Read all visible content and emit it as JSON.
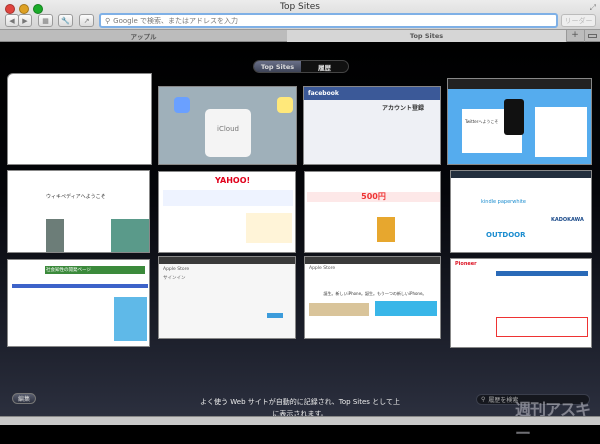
{
  "window": {
    "title": "Top Sites"
  },
  "toolbar": {
    "back": "◀",
    "forward": "▶",
    "address_placeholder": "Google で検索、またはアドレスを入力",
    "reader_label": "リーダー"
  },
  "tabs": [
    {
      "label": "アップル",
      "active": false
    },
    {
      "label": "Top Sites",
      "active": true
    }
  ],
  "tab_actions": {
    "new_tab": "+"
  },
  "segmented": {
    "top_sites": "Top Sites",
    "history": "履歴"
  },
  "thumbnails": [
    {
      "name": "blank",
      "label": ""
    },
    {
      "name": "icloud",
      "label": "iCloud"
    },
    {
      "name": "facebook",
      "label": "facebook",
      "sub": "アカウント登録"
    },
    {
      "name": "twitter",
      "label": "Twitterへようこそ"
    },
    {
      "name": "wikipedia",
      "label": "ウィキペディアへようこそ"
    },
    {
      "name": "yahoo",
      "label": "YAHOO!"
    },
    {
      "name": "news",
      "label": "500円"
    },
    {
      "name": "amazon",
      "label": "kindle paperwhite",
      "sub": "OUTDOOR",
      "sub2": "KADOKAWA"
    },
    {
      "name": "tokyo-online",
      "label": "社会知性の開発ページ"
    },
    {
      "name": "apple-store-signin",
      "label": "Apple Store",
      "sub": "サインイン"
    },
    {
      "name": "apple-store",
      "label": "Apple Store",
      "sub": "誕生。新しいiPhone。誕生。もう一つの新しいiPhone。"
    },
    {
      "name": "pioneer",
      "label": "Pioneer"
    }
  ],
  "message": "よく使う Web サイトが自動的に記録され、Top Sites として上に表示されます。",
  "edit_label": "編集",
  "search_placeholder": "履歴を検索",
  "watermark": "週刊アスキー",
  "colors": {
    "close": "#e0443e",
    "minimize": "#dea123",
    "zoom": "#1aab29",
    "focus": "#7fb0e6"
  }
}
